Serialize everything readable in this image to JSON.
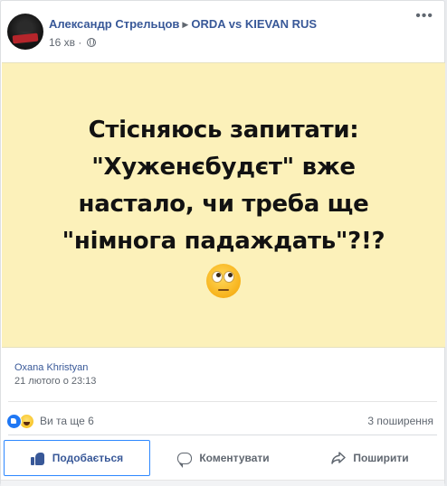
{
  "header": {
    "author": "Александр Стрельцов",
    "group": "ORDA vs KIEVAN RUS",
    "time": "16 хв",
    "separator": "·"
  },
  "image": {
    "lines": [
      "Стісняюсь запитати:",
      "\"Хуженєбудєт\" вже",
      "настало, чи треба ще",
      "\"німнога падаждать\"?!?"
    ],
    "emoji_icon": "face-with-rolling-eyes-icon",
    "background": "#fcf1ba"
  },
  "shared_from": {
    "name": "Oxana Khristyan",
    "date": "21 лютого о 23:13"
  },
  "reactions": {
    "icons": [
      "like-reaction-icon",
      "haha-reaction-icon"
    ],
    "summary": "Ви та ще 6",
    "shares": "3 поширення"
  },
  "actions": {
    "like": "Подобається",
    "comment": "Коментувати",
    "share": "Поширити"
  },
  "colors": {
    "link": "#385898",
    "like_blue": "#2078f4",
    "muted": "#606770"
  }
}
